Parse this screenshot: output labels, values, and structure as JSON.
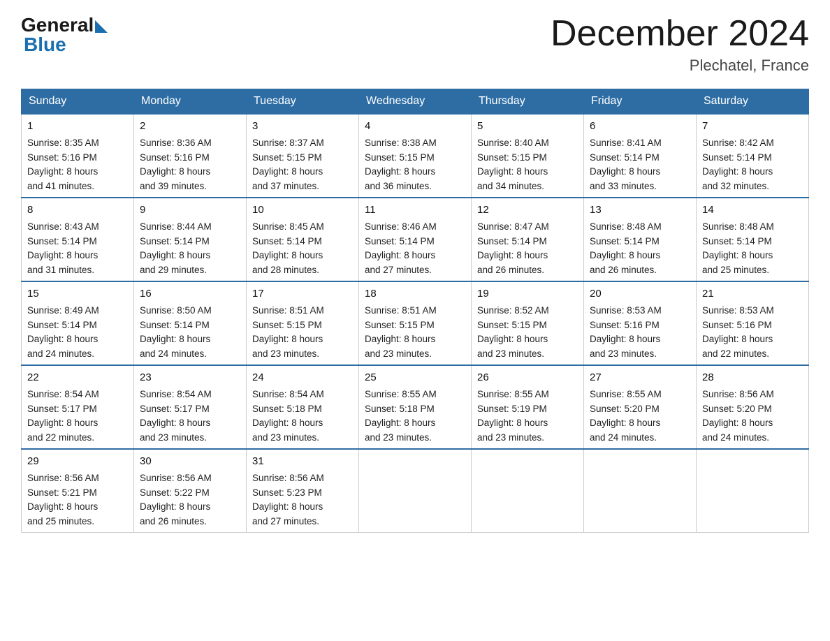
{
  "header": {
    "logo_general": "General",
    "logo_blue": "Blue",
    "title": "December 2024",
    "location": "Plechatel, France"
  },
  "days_of_week": [
    "Sunday",
    "Monday",
    "Tuesday",
    "Wednesday",
    "Thursday",
    "Friday",
    "Saturday"
  ],
  "weeks": [
    [
      {
        "day": "1",
        "sunrise": "8:35 AM",
        "sunset": "5:16 PM",
        "daylight": "8 hours and 41 minutes."
      },
      {
        "day": "2",
        "sunrise": "8:36 AM",
        "sunset": "5:16 PM",
        "daylight": "8 hours and 39 minutes."
      },
      {
        "day": "3",
        "sunrise": "8:37 AM",
        "sunset": "5:15 PM",
        "daylight": "8 hours and 37 minutes."
      },
      {
        "day": "4",
        "sunrise": "8:38 AM",
        "sunset": "5:15 PM",
        "daylight": "8 hours and 36 minutes."
      },
      {
        "day": "5",
        "sunrise": "8:40 AM",
        "sunset": "5:15 PM",
        "daylight": "8 hours and 34 minutes."
      },
      {
        "day": "6",
        "sunrise": "8:41 AM",
        "sunset": "5:14 PM",
        "daylight": "8 hours and 33 minutes."
      },
      {
        "day": "7",
        "sunrise": "8:42 AM",
        "sunset": "5:14 PM",
        "daylight": "8 hours and 32 minutes."
      }
    ],
    [
      {
        "day": "8",
        "sunrise": "8:43 AM",
        "sunset": "5:14 PM",
        "daylight": "8 hours and 31 minutes."
      },
      {
        "day": "9",
        "sunrise": "8:44 AM",
        "sunset": "5:14 PM",
        "daylight": "8 hours and 29 minutes."
      },
      {
        "day": "10",
        "sunrise": "8:45 AM",
        "sunset": "5:14 PM",
        "daylight": "8 hours and 28 minutes."
      },
      {
        "day": "11",
        "sunrise": "8:46 AM",
        "sunset": "5:14 PM",
        "daylight": "8 hours and 27 minutes."
      },
      {
        "day": "12",
        "sunrise": "8:47 AM",
        "sunset": "5:14 PM",
        "daylight": "8 hours and 26 minutes."
      },
      {
        "day": "13",
        "sunrise": "8:48 AM",
        "sunset": "5:14 PM",
        "daylight": "8 hours and 26 minutes."
      },
      {
        "day": "14",
        "sunrise": "8:48 AM",
        "sunset": "5:14 PM",
        "daylight": "8 hours and 25 minutes."
      }
    ],
    [
      {
        "day": "15",
        "sunrise": "8:49 AM",
        "sunset": "5:14 PM",
        "daylight": "8 hours and 24 minutes."
      },
      {
        "day": "16",
        "sunrise": "8:50 AM",
        "sunset": "5:14 PM",
        "daylight": "8 hours and 24 minutes."
      },
      {
        "day": "17",
        "sunrise": "8:51 AM",
        "sunset": "5:15 PM",
        "daylight": "8 hours and 23 minutes."
      },
      {
        "day": "18",
        "sunrise": "8:51 AM",
        "sunset": "5:15 PM",
        "daylight": "8 hours and 23 minutes."
      },
      {
        "day": "19",
        "sunrise": "8:52 AM",
        "sunset": "5:15 PM",
        "daylight": "8 hours and 23 minutes."
      },
      {
        "day": "20",
        "sunrise": "8:53 AM",
        "sunset": "5:16 PM",
        "daylight": "8 hours and 23 minutes."
      },
      {
        "day": "21",
        "sunrise": "8:53 AM",
        "sunset": "5:16 PM",
        "daylight": "8 hours and 22 minutes."
      }
    ],
    [
      {
        "day": "22",
        "sunrise": "8:54 AM",
        "sunset": "5:17 PM",
        "daylight": "8 hours and 22 minutes."
      },
      {
        "day": "23",
        "sunrise": "8:54 AM",
        "sunset": "5:17 PM",
        "daylight": "8 hours and 23 minutes."
      },
      {
        "day": "24",
        "sunrise": "8:54 AM",
        "sunset": "5:18 PM",
        "daylight": "8 hours and 23 minutes."
      },
      {
        "day": "25",
        "sunrise": "8:55 AM",
        "sunset": "5:18 PM",
        "daylight": "8 hours and 23 minutes."
      },
      {
        "day": "26",
        "sunrise": "8:55 AM",
        "sunset": "5:19 PM",
        "daylight": "8 hours and 23 minutes."
      },
      {
        "day": "27",
        "sunrise": "8:55 AM",
        "sunset": "5:20 PM",
        "daylight": "8 hours and 24 minutes."
      },
      {
        "day": "28",
        "sunrise": "8:56 AM",
        "sunset": "5:20 PM",
        "daylight": "8 hours and 24 minutes."
      }
    ],
    [
      {
        "day": "29",
        "sunrise": "8:56 AM",
        "sunset": "5:21 PM",
        "daylight": "8 hours and 25 minutes."
      },
      {
        "day": "30",
        "sunrise": "8:56 AM",
        "sunset": "5:22 PM",
        "daylight": "8 hours and 26 minutes."
      },
      {
        "day": "31",
        "sunrise": "8:56 AM",
        "sunset": "5:23 PM",
        "daylight": "8 hours and 27 minutes."
      },
      null,
      null,
      null,
      null
    ]
  ],
  "labels": {
    "sunrise": "Sunrise:",
    "sunset": "Sunset:",
    "daylight": "Daylight:"
  }
}
